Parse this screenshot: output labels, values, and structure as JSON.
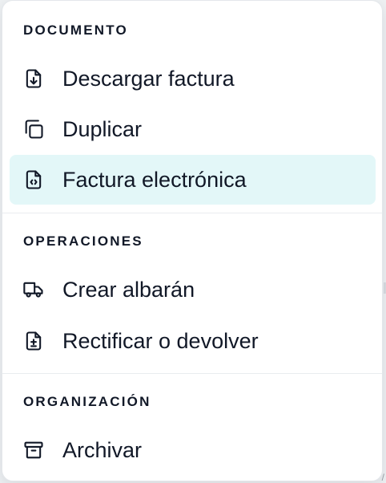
{
  "menu": {
    "sections": [
      {
        "header": "DOCUMENTO",
        "items": [
          {
            "label": "Descargar factura",
            "icon": "file-download-icon",
            "active": false
          },
          {
            "label": "Duplicar",
            "icon": "copy-icon",
            "active": false
          },
          {
            "label": "Factura electrónica",
            "icon": "file-code-icon",
            "active": true
          }
        ]
      },
      {
        "header": "OPERACIONES",
        "items": [
          {
            "label": "Crear albarán",
            "icon": "truck-icon",
            "active": false
          },
          {
            "label": "Rectificar o devolver",
            "icon": "file-plus-minus-icon",
            "active": false
          }
        ]
      },
      {
        "header": "ORGANIZACIÓN",
        "items": [
          {
            "label": "Archivar",
            "icon": "archive-icon",
            "active": false
          }
        ]
      }
    ]
  },
  "colors": {
    "text": "#111827",
    "active_background": "#e3f7f8",
    "divider": "#e9ecef"
  }
}
